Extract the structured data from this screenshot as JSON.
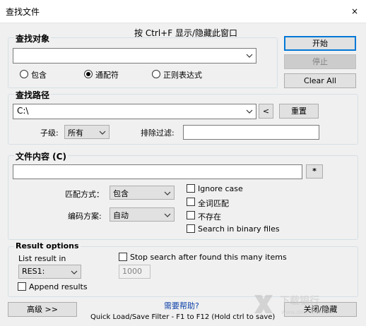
{
  "window": {
    "title": "查找文件",
    "close_glyph": "×"
  },
  "hint": "按 Ctrl+F 显示/隐藏此窗口",
  "find_target": {
    "title": "查找对象",
    "value": "",
    "options": [
      {
        "label": "包含",
        "selected": false
      },
      {
        "label": "通配符",
        "selected": true
      },
      {
        "label": "正则表达式",
        "selected": false
      }
    ]
  },
  "side_buttons": {
    "start": "开始",
    "stop": "停止",
    "clear_all": "Clear All"
  },
  "find_path": {
    "title": "查找路径",
    "path_value": "C:\\",
    "back_label": "<",
    "reset_label": "重置",
    "sublevel_label": "子级:",
    "sublevel_value": "所有",
    "exclude_label": "排除过滤:",
    "exclude_value": ""
  },
  "file_content": {
    "title": "文件内容 (C)",
    "value": "",
    "star_label": "*",
    "match_label": "匹配方式：",
    "match_value": "包含",
    "encoding_label": "编码方案:",
    "encoding_value": "自动",
    "checks": [
      {
        "label": "Ignore case",
        "checked": false
      },
      {
        "label": "全词匹配",
        "checked": false
      },
      {
        "label": "不存在",
        "checked": false
      },
      {
        "label": "Search in binary files",
        "checked": false
      }
    ]
  },
  "result_options": {
    "title": "Result options",
    "list_label": "List result in",
    "list_value": "RES1:",
    "stop_label": "Stop search after found this many items",
    "stop_checked": false,
    "stop_count": "1000",
    "append_label": "Append results",
    "append_checked": false
  },
  "footer": {
    "advanced_label": "高级 >>",
    "help_link": "需要帮助?",
    "quick_filter": "Quick Load/Save Filter - F1 to F12 (Hold ctrl to save)",
    "close_hide_label": "关闭/隐藏"
  },
  "watermark": {
    "text": "下载银行",
    "url": "www.downbank.cn"
  },
  "colors": {
    "primary_border": "#0078d7",
    "link": "#0b3fa8",
    "frame": "#d5dfe5"
  }
}
